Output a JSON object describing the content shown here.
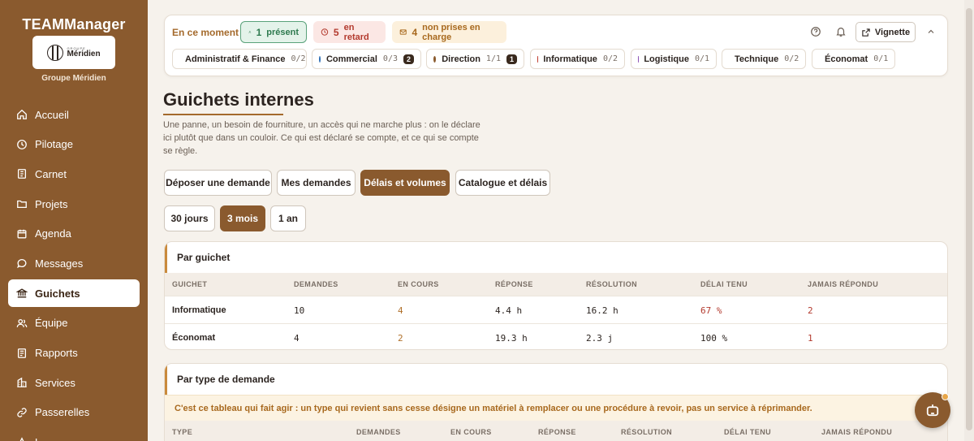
{
  "sidebar": {
    "brand": "TEAMManager",
    "logo_small": "GROUPE",
    "logo_big": "Méridien",
    "org": "Groupe Méridien",
    "items": [
      {
        "label": "Accueil",
        "icon": "home-icon"
      },
      {
        "label": "Pilotage",
        "icon": "clock-icon"
      },
      {
        "label": "Carnet",
        "icon": "book-icon"
      },
      {
        "label": "Projets",
        "icon": "folder-icon"
      },
      {
        "label": "Agenda",
        "icon": "calendar-icon"
      },
      {
        "label": "Messages",
        "icon": "chat-icon"
      },
      {
        "label": "Guichets",
        "icon": "bank-icon",
        "active": true
      },
      {
        "label": "Équipe",
        "icon": "users-icon"
      },
      {
        "label": "Rapports",
        "icon": "report-icon"
      },
      {
        "label": "Services",
        "icon": "building-icon"
      },
      {
        "label": "Passerelles",
        "icon": "link-icon"
      },
      {
        "label": "L",
        "icon": "extra-icon"
      }
    ]
  },
  "top": {
    "now_label": "En ce moment",
    "present": {
      "count": "1",
      "label": "présent"
    },
    "late": {
      "count": "5",
      "label": "en retard"
    },
    "unassigned": {
      "count": "4",
      "label": "non prises en charge"
    },
    "vignette": "Vignette",
    "teams": [
      {
        "name": "Administratif & Finance",
        "ratio": "0/2",
        "color": "#3f7a55"
      },
      {
        "name": "Commercial",
        "ratio": "0/3",
        "badge": "2",
        "color": "#2f6fb5"
      },
      {
        "name": "Direction",
        "ratio": "1/1",
        "badge": "1",
        "color": "#8a5a2e"
      },
      {
        "name": "Informatique",
        "ratio": "0/2",
        "color": "#c0392b"
      },
      {
        "name": "Logistique",
        "ratio": "0/1",
        "color": "#8a4fb5"
      },
      {
        "name": "Technique",
        "ratio": "0/2",
        "color": "#c98a1e"
      },
      {
        "name": "Économat",
        "ratio": "0/1",
        "color": "#4f7a5a"
      }
    ]
  },
  "page": {
    "title": "Guichets internes",
    "description": "Une panne, un besoin de fourniture, un accès qui ne marche plus : on le déclare ici plutôt que dans un couloir. Ce qui est déclaré se compte, et ce qui se compte se règle.",
    "tabs": [
      "Déposer une demande",
      "Mes demandes",
      "Délais et volumes",
      "Catalogue et délais"
    ],
    "active_tab": "Délais et volumes",
    "periods": [
      "30 jours",
      "3 mois",
      "1 an"
    ],
    "active_period": "3 mois"
  },
  "by_desk": {
    "title": "Par guichet",
    "columns": [
      "GUICHET",
      "DEMANDES",
      "EN COURS",
      "RÉPONSE",
      "RÉSOLUTION",
      "DÉLAI TENU",
      "JAMAIS RÉPONDU"
    ],
    "rows": [
      [
        "Informatique",
        "10",
        "4",
        "4.4 h",
        "16.2 h",
        "67 %",
        "2"
      ],
      [
        "Économat",
        "4",
        "2",
        "19.3 h",
        "2.3 j",
        "100 %",
        "1"
      ]
    ]
  },
  "by_type": {
    "title": "Par type de demande",
    "note": "C'est ce tableau qui fait agir : un type qui revient sans cesse désigne un matériel à remplacer ou une procédure à revoir, pas un service à réprimander.",
    "columns": [
      "TYPE",
      "DEMANDES",
      "EN COURS",
      "RÉPONSE",
      "RÉSOLUTION",
      "DÉLAI TENU",
      "JAMAIS RÉPONDU"
    ]
  }
}
